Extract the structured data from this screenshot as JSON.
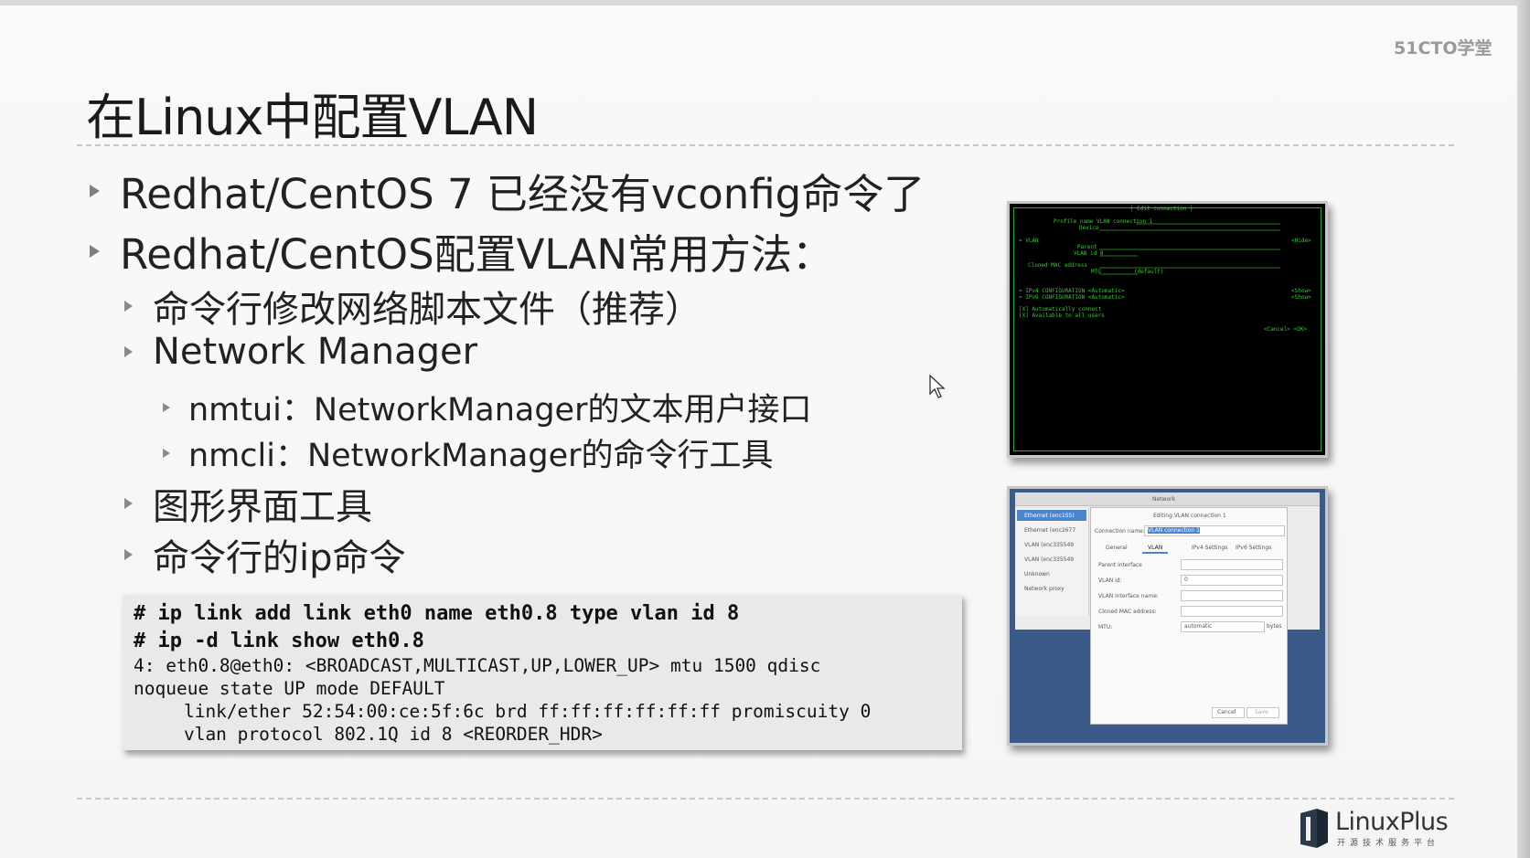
{
  "brand": "51CTO学堂",
  "title": "在Linux中配置VLAN",
  "bullets": {
    "b1": "Redhat/CentOS 7 已经没有vconfig命令了",
    "b2": "Redhat/CentOS配置VLAN常用方法：",
    "b2_1": "命令行修改网络脚本文件（推荐）",
    "b2_2": "Network Manager",
    "b2_2_1": "nmtui：NetworkManager的文本用户接口",
    "b2_2_2": "nmcli：NetworkManager的命令行工具",
    "b2_3": "图形界面工具",
    "b2_4": "命令行的ip命令"
  },
  "code": {
    "cmd1": "# ip link add link eth0 name eth0.8 type vlan id 8",
    "cmd2": "# ip -d link show eth0.8",
    "out1": "4: eth0.8@eth0: <BROADCAST,MULTICAST,UP,LOWER_UP> mtu 1500 qdisc",
    "out2": "noqueue state UP mode DEFAULT",
    "out3": "    link/ether 52:54:00:ce:5f:6c brd ff:ff:ff:ff:ff:ff promiscuity 0",
    "out4": "    vlan protocol 802.1Q id 8 <REORDER_HDR>"
  },
  "nmtui": {
    "header": "┤ Edit connection ├",
    "l1": "Profile name VLAN connection 1",
    "l2": "Device",
    "l3": "= VLAN",
    "l3r": "<Hide>",
    "l4": "Parent",
    "l5": "VLAN id 8",
    "l6": "Cloned MAC address",
    "l7": "MTU          (default)",
    "l8": "= IPv4 CONFIGURATION <Automatic>",
    "l8r": "<Show>",
    "l9": "= IPv6 CONFIGURATION <Automatic>",
    "l9r": "<Show>",
    "l10": "[X] Automatically connect",
    "l11": "[X] Available to all users",
    "l12": "<Cancel> <OK>"
  },
  "gui": {
    "window_title": "Network",
    "dialog_title": "Editing VLAN connection 1",
    "conn_name_label": "Connection name:",
    "conn_name_value": "VLAN connection 1",
    "tabs": [
      "General",
      "VLAN",
      "IPv4 Settings",
      "IPv6 Settings"
    ],
    "sidebar": [
      "Ethernet (enc1S5)",
      "Ethernet (enc2677",
      "VLAN (enc335549",
      "VLAN (enc335549",
      "Unknown",
      "Network proxy"
    ],
    "fields": [
      "Parent interface",
      "VLAN id:",
      "VLAN interface name:",
      "Cloned MAC address:",
      "MTU:"
    ],
    "vlan_id_value": "0",
    "mtu_value": "automatic",
    "mtu_unit": "bytes",
    "cancel": "Cancel",
    "save": "Save"
  },
  "logo": {
    "name": "LinuxPlus",
    "tagline": "开源技术服务平台"
  }
}
